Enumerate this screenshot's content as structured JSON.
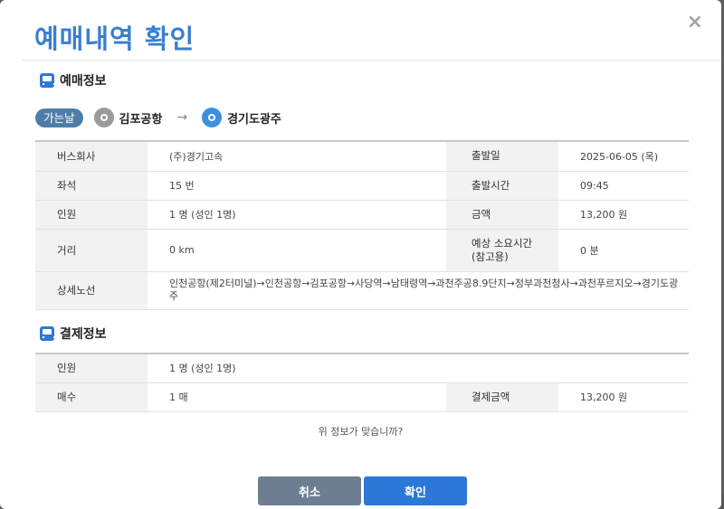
{
  "dialog": {
    "title": "예매내역 확인",
    "close_label": "×"
  },
  "booking_section": {
    "title": "예매정보",
    "route": {
      "direction_badge": "가는날",
      "origin": "김포공항",
      "arrow": "→",
      "destination": "경기도광주"
    },
    "rows": {
      "company_label": "버스회사",
      "company_value": "(주)경기고속",
      "departure_date_label": "출발일",
      "departure_date_value": "2025-06-05 (목)",
      "seat_label": "좌석",
      "seat_value": "15 번",
      "departure_time_label": "출발시간",
      "departure_time_value": "09:45",
      "passengers_label": "인원",
      "passengers_value": "1 명 (성인 1명)",
      "amount_label": "금액",
      "amount_value": "13,200 원",
      "distance_label": "거리",
      "distance_value": "0 km",
      "duration_label_line1": "예상 소요시간",
      "duration_label_line2": "(참고용)",
      "duration_value": "0 분",
      "route_detail_label": "상세노선",
      "route_detail_value": "인천공항(제2터미널)→인천공항→김포공항→사당역→남태령역→과천주공8.9단지→정부과천청사→과천푸르지오→경기도광주"
    }
  },
  "payment_section": {
    "title": "결제정보",
    "rows": {
      "passengers_label": "인원",
      "passengers_value": "1 명 (성인 1명)",
      "tickets_label": "매수",
      "tickets_value": "1 매",
      "payment_amount_label": "결제금액",
      "payment_amount_value": "13,200 원"
    }
  },
  "confirm_question": "위 정보가 맞습니까?",
  "buttons": {
    "cancel": "취소",
    "confirm": "확인"
  },
  "colors": {
    "title_blue": "#3a7fd0",
    "confirm_button": "#2c78d6",
    "cancel_button": "#6d7e92",
    "badge": "#4e7ea8"
  }
}
